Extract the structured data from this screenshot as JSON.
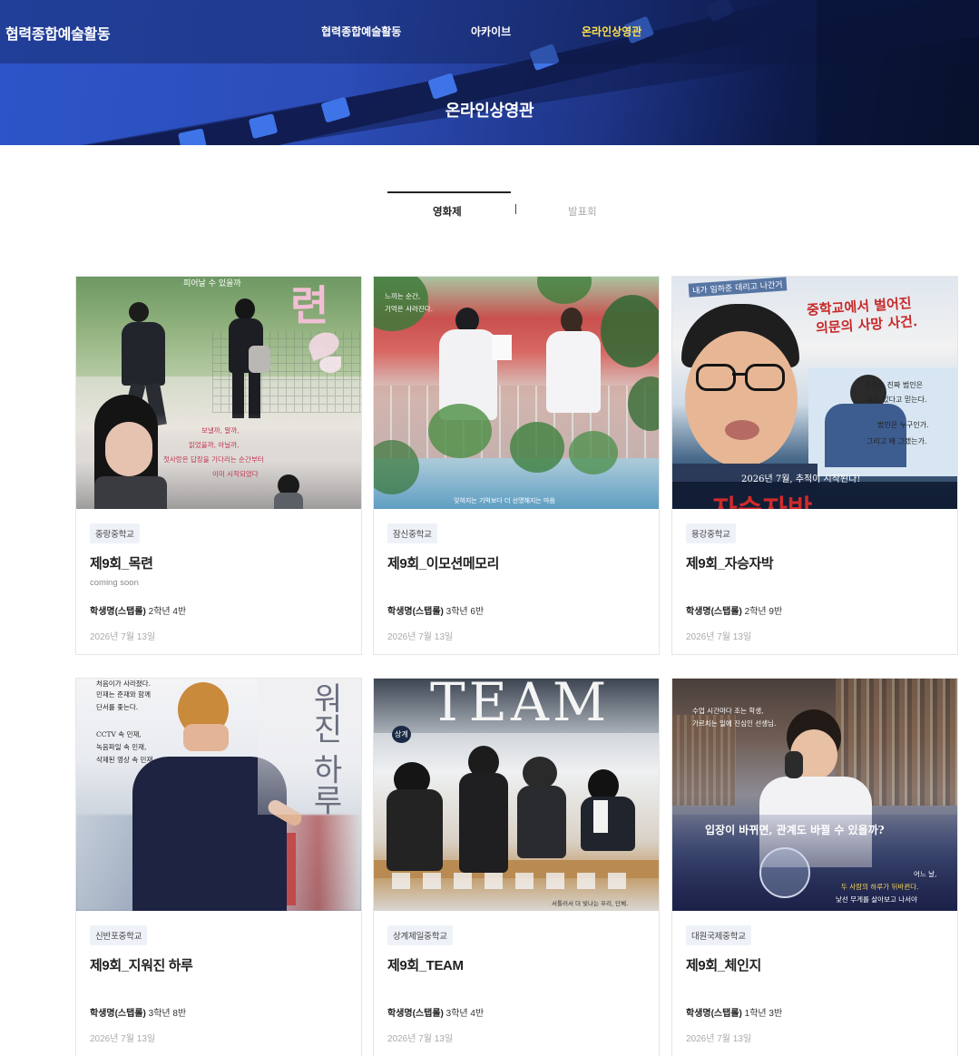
{
  "header": {
    "site_title": "협력종합예술활동",
    "nav": [
      {
        "label": "협력종합예술활동",
        "active": false
      },
      {
        "label": "아카이브",
        "active": false
      },
      {
        "label": "온라인상영관",
        "active": true
      }
    ],
    "page_title": "온라인상영관"
  },
  "tabs": [
    {
      "label": "영화제",
      "active": true
    },
    {
      "label": "발표회",
      "active": false
    }
  ],
  "cards": [
    {
      "school": "중랑중학교",
      "title": "제9회_목련",
      "subtitle": "coming soon",
      "student_label": "학생명(스탭롤)",
      "student_class": "2학년 4반",
      "date": "2026년 7월 13일",
      "poster_text": [
        "피어날 수 있을까",
        "련",
        "보낼까, 말까,",
        "읽었을까, 아닐까,",
        "첫사랑은 답장을 기다리는 순간부터",
        "이미 시작되었다"
      ]
    },
    {
      "school": "잠신중학교",
      "title": "제9회_이모션메모리",
      "subtitle": "",
      "student_label": "학생명(스탭롤)",
      "student_class": "3학년 6반",
      "date": "2026년 7월 13일",
      "poster_text": [
        "느끼는 순간,",
        "기억은 사라진다.",
        "잊혀지는 기억보다 더 선명해지는 마음"
      ]
    },
    {
      "school": "용강중학교",
      "title": "제9회_자승자박",
      "subtitle": "",
      "student_label": "학생명(스탭롤)",
      "student_class": "2학년 9반",
      "date": "2026년 7월 13일",
      "poster_text": [
        "내가 임하준 데리고 나간거",
        "중학교에서 벌어진",
        "의문의 사망 사건.",
        "준호는 진짜 범인은",
        "따로 있다고 믿는다.",
        "범인은 누구인가.",
        "그리고 왜 그랬는가.",
        "2026년 7월, 추적이 시작된다!",
        "자승자박"
      ]
    },
    {
      "school": "신반포중학교",
      "title": "제9회_지워진 하루",
      "subtitle": "",
      "student_label": "학생명(스탭롤)",
      "student_class": "3학년 8반",
      "date": "2026년 7월 13일",
      "poster_text": [
        "처음이가 사라졌다.",
        "민재는 준재와 함께",
        "단서를 좇는다.",
        "CCTV 속 민재,",
        "녹음파일 속 민재,",
        "삭제된 영상 속 민재.",
        "워진 하루"
      ]
    },
    {
      "school": "상계제일중학교",
      "title": "제9회_TEAM",
      "subtitle": "",
      "student_label": "학생명(스탭롤)",
      "student_class": "3학년 4반",
      "date": "2026년 7월 13일",
      "poster_text": [
        "TEAM",
        "상계",
        "서툴러서 더 빛나는 우리, 단체."
      ]
    },
    {
      "school": "대원국제중학교",
      "title": "제9회_체인지",
      "subtitle": "",
      "student_label": "학생명(스탭롤)",
      "student_class": "1학년 3반",
      "date": "2026년 7월 13일",
      "poster_text": [
        "수업 시간마다 조는 학생,",
        "가르치는 일에 진심인 선생님.",
        "입장이 바뀌면, 관계도 바뀔 수 있을까?",
        "어느 날,",
        "두 사람의 하루가 뒤바뀐다.",
        "낯선 무게를 살아보고 나서야"
      ]
    }
  ]
}
